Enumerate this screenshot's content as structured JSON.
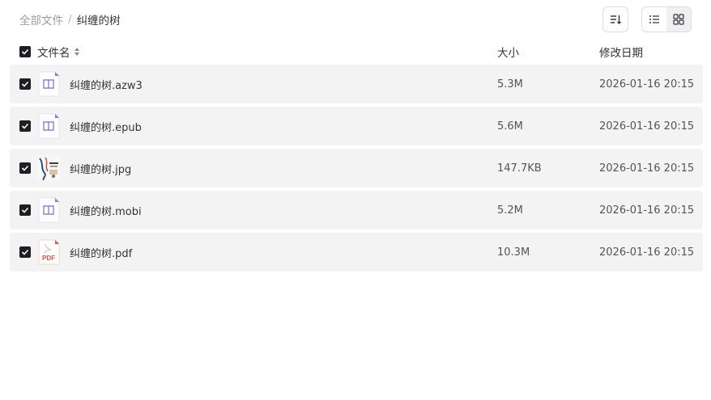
{
  "breadcrumb": {
    "root": "全部文件",
    "separator": "/",
    "current": "纠缠的树"
  },
  "header": {
    "name": "文件名",
    "size": "大小",
    "modified": "修改日期"
  },
  "files": [
    {
      "name": "纠缠的树.azw3",
      "size": "5.3M",
      "date": "2026-01-16 20:15",
      "icon": "ebook-icon"
    },
    {
      "name": "纠缠的树.epub",
      "size": "5.6M",
      "date": "2026-01-16 20:15",
      "icon": "ebook-icon"
    },
    {
      "name": "纠缠的树.jpg",
      "size": "147.7KB",
      "date": "2026-01-16 20:15",
      "icon": "image-thumbnail"
    },
    {
      "name": "纠缠的树.mobi",
      "size": "5.2M",
      "date": "2026-01-16 20:15",
      "icon": "ebook-icon"
    },
    {
      "name": "纠缠的树.pdf",
      "size": "10.3M",
      "date": "2026-01-16 20:15",
      "icon": "pdf-icon",
      "icon_text": "PDF"
    }
  ],
  "colors": {
    "ebook": "#8a7fe0",
    "pdf": "#e5534b",
    "checkbox": "#1d1f24",
    "row_bg": "#f3f3f4"
  }
}
